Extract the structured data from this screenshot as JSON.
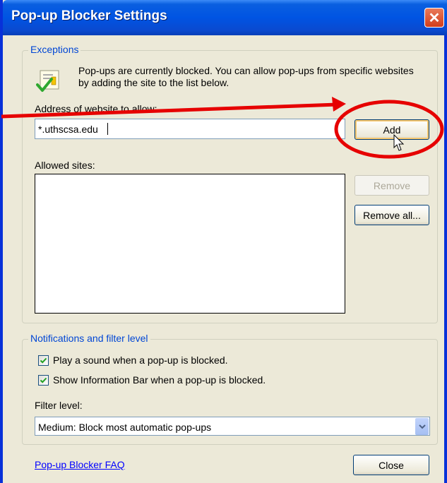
{
  "window": {
    "title": "Pop-up Blocker Settings",
    "close_symbol": "✕"
  },
  "exceptions": {
    "legend": "Exceptions",
    "info_text": "Pop-ups are currently blocked.  You can allow pop-ups from specific websites by adding the site to the list below.",
    "address_label": "Address of website to allow:",
    "address_value": "*.uthscsa.edu",
    "add_label": "Add",
    "allowed_label": "Allowed sites:",
    "allowed_sites": [],
    "remove_label": "Remove",
    "remove_all_label": "Remove all..."
  },
  "notifications": {
    "legend": "Notifications and filter level",
    "play_sound_label": "Play a sound when a pop-up is blocked.",
    "play_sound_checked": true,
    "show_infobar_label": "Show Information Bar when a pop-up is blocked.",
    "show_infobar_checked": true,
    "filter_label": "Filter level:",
    "filter_value": "Medium: Block most automatic pop-ups"
  },
  "footer": {
    "faq_link": "Pop-up Blocker FAQ",
    "close_label": "Close"
  },
  "icons": {
    "shield": "shield-check-icon",
    "close": "close-icon",
    "dropdown": "chevron-down-icon",
    "checkmark": "checkmark-icon",
    "cursor": "mouse-cursor-icon"
  },
  "colors": {
    "titlebar": "#0054e3",
    "dialog_bg": "#ece9d8",
    "annotation": "#e60000",
    "link": "#0000ff"
  }
}
